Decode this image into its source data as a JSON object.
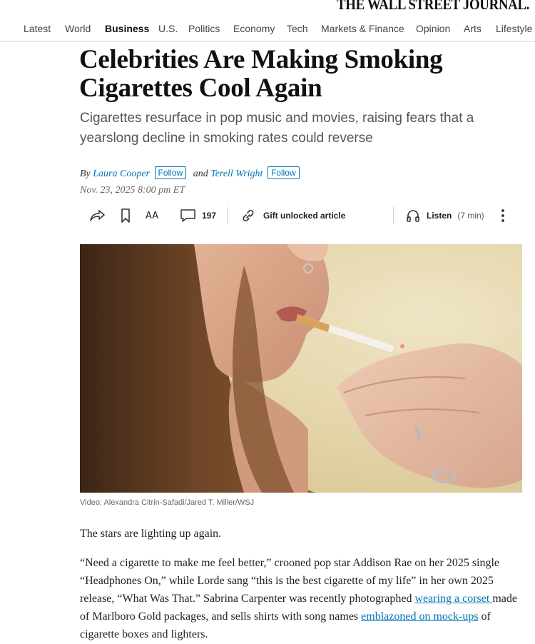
{
  "masthead": "THE WALL STREET JOURNAL.",
  "nav": {
    "items": [
      "Latest",
      "World",
      "Business",
      "U.S.",
      "Politics",
      "Economy",
      "Tech",
      "Markets & Finance",
      "Opinion",
      "Arts",
      "Lifestyle"
    ],
    "active": "Business"
  },
  "article": {
    "headline": "Celebrities Are Making Smoking Cigarettes Cool Again",
    "dek": "Cigarettes resurface in pop music and movies, raising fears that a yearslong decline in smoking rates could reverse",
    "byline": {
      "by": "By",
      "author1": "Laura Cooper",
      "and": "and",
      "author2": "Terell Wright",
      "follow_label": "Follow"
    },
    "date": "Nov. 23, 2025 8:00 pm ET"
  },
  "toolbar": {
    "share_icon": "share-icon",
    "bookmark_icon": "bookmark-icon",
    "text_size_label": "AA",
    "comments_count": "197",
    "gift_label": "Gift unlocked article",
    "listen_label": "Listen",
    "listen_duration": "(7 min)"
  },
  "media": {
    "caption": "Video: Alexandra Citrin-Safadi/Jared T. Miller/WSJ"
  },
  "body": {
    "p1": "The stars are lighting up again.",
    "p2_a": "“Need a cigarette to make me feel better,” crooned pop star Addison Rae on her 2025 single “Headphones On,” while Lorde sang “this is the best cigarette of my life” in her own 2025 release, “What Was That.” Sabrina Carpenter was recently photographed ",
    "p2_link1": "wearing a corset ",
    "p2_b": "made of Marlboro Gold packages, and sells shirts with song names ",
    "p2_link2": "emblazoned on mock-ups",
    "p2_c": " of cigarette boxes and lighters."
  },
  "colors": {
    "link": "#0274b6",
    "headline": "#111111",
    "dek": "#555555"
  }
}
